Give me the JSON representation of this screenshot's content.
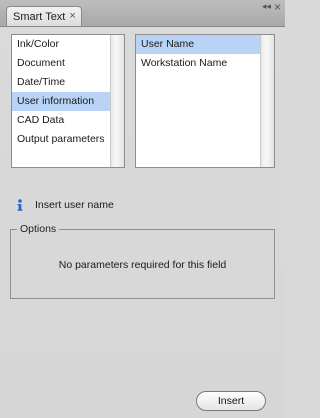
{
  "panel": {
    "tab_label": "Smart Text",
    "tab_close": "×",
    "collapse_glyph": "◂◂",
    "close_glyph": "×"
  },
  "categories": {
    "items": [
      {
        "label": "Ink/Color",
        "selected": false
      },
      {
        "label": "Document",
        "selected": false
      },
      {
        "label": "Date/Time",
        "selected": false
      },
      {
        "label": "User information",
        "selected": true
      },
      {
        "label": "CAD Data",
        "selected": false
      },
      {
        "label": "Output parameters",
        "selected": false
      }
    ]
  },
  "fields": {
    "items": [
      {
        "label": "User Name",
        "selected": true
      },
      {
        "label": "Workstation Name",
        "selected": false
      }
    ]
  },
  "info": {
    "icon": "info-icon",
    "text": "Insert user name"
  },
  "options": {
    "legend": "Options",
    "message": "No parameters required for this field"
  },
  "actions": {
    "insert_label": "Insert"
  },
  "colors": {
    "selection": "#b8d3f5",
    "panel_bg": "#d8d8d8"
  }
}
